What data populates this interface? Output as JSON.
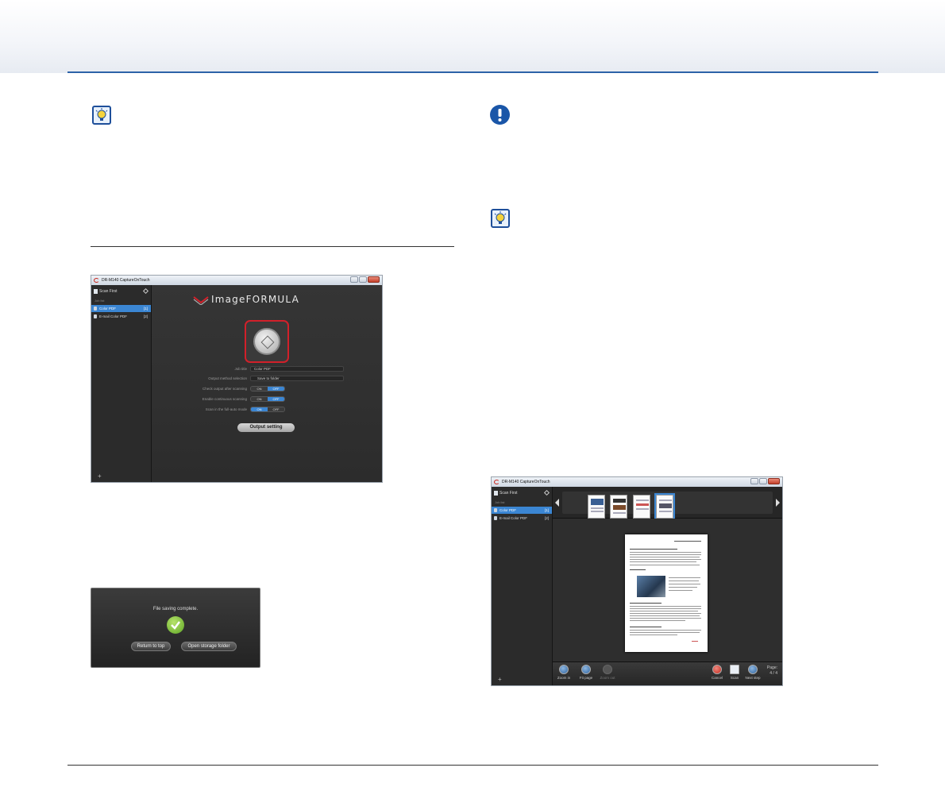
{
  "window1": {
    "title": "DR-M140 CaptureOnTouch",
    "brand": "ImageFORMULA",
    "scan_first": "Scan First",
    "job_list_label": "Job list",
    "jobs": [
      {
        "name": "Color PDF",
        "num": "[1]"
      },
      {
        "name": "E-mail Color PDF",
        "num": "[2]"
      }
    ],
    "form": {
      "job_title_label": "Job title",
      "job_title_value": "Color PDF",
      "output_method_label": "Output method selection",
      "output_method_value": "Save to folder",
      "check_output_label": "Check output after scanning",
      "continuous_label": "Enable continuous scanning",
      "fullauto_label": "Scan in the full-auto mode",
      "on": "ON",
      "off": "OFF"
    },
    "output_setting": "Output setting"
  },
  "dialog": {
    "message": "File saving complete.",
    "return_label": "Return to top",
    "open_folder_label": "Open storage folder"
  },
  "window2": {
    "title": "DR-M140 CaptureOnTouch",
    "scan_first": "Scan First",
    "job_list_label": "Job list",
    "jobs": [
      {
        "name": "Color PDF",
        "num": "[1]"
      },
      {
        "name": "E-mail Color PDF",
        "num": "[2]"
      }
    ],
    "toolbar": {
      "zoom_in": "Zoom in",
      "fit_page": "Fit page",
      "zoom_out": "Zoom out",
      "cancel": "Cancel",
      "scan": "Scan",
      "next_step": "Next step",
      "page_label": "Page:",
      "page_value": "4 / 4"
    }
  },
  "colors": {
    "accent": "#3b86d3",
    "highlight_frame": "#d2202a",
    "header_rule": "#2c62a8"
  }
}
